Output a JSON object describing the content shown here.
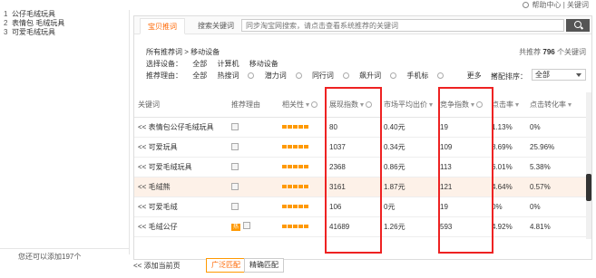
{
  "top_help": "帮助中心 | 关键词",
  "sidebar": {
    "items": [
      {
        "idx": "1",
        "label": "公仔毛绒玩具"
      },
      {
        "idx": "2",
        "label": "表情包 毛绒玩具"
      },
      {
        "idx": "3",
        "label": "可爱毛绒玩具"
      }
    ],
    "footer": "您还可以添加197个"
  },
  "tabs": {
    "active": "宝贝推词",
    "other": "搜索关键词"
  },
  "search": {
    "placeholder": "同步淘宝网搜索，请点击查看系统推荐的关键词"
  },
  "breadcrumb": "所有推荐词 > 移动设备",
  "total": {
    "prefix": "共推荐",
    "count": "796",
    "suffix": "个关键词"
  },
  "filters": {
    "device_label": "选择设备：",
    "device_options": [
      "全部",
      "计算机",
      "移动设备"
    ],
    "recommend_label": "推荐理由：",
    "recommend_options": [
      "全部",
      "热搜词",
      "潜力词",
      "同行词",
      "飙升词",
      "手机标"
    ],
    "more": "更多"
  },
  "sort": {
    "label": "搭配排序：",
    "value": "全部"
  },
  "table": {
    "headers": [
      "关键词",
      "推荐理由",
      "相关性",
      "展现指数",
      "市场平均出价",
      "竞争指数",
      "点击率",
      "点击转化率"
    ],
    "rows": [
      {
        "keyword": "<< 表情包公仔毛绒玩具",
        "impressions": "80",
        "price": "0.40元",
        "competition": "19",
        "ctr": "1.13%",
        "cvr": "0%",
        "hot": ""
      },
      {
        "keyword": "<< 可爱玩具",
        "impressions": "1037",
        "price": "0.34元",
        "competition": "109",
        "ctr": "8.69%",
        "cvr": "25.96%",
        "hot": ""
      },
      {
        "keyword": "<< 可爱毛绒玩具",
        "impressions": "2368",
        "price": "0.86元",
        "competition": "113",
        "ctr": "6.01%",
        "cvr": "5.38%",
        "hot": ""
      },
      {
        "keyword": "<< 毛绒熊",
        "impressions": "3161",
        "price": "1.87元",
        "competition": "121",
        "ctr": "4.64%",
        "cvr": "0.57%",
        "hot": ""
      },
      {
        "keyword": "<< 可爱毛绒",
        "impressions": "106",
        "price": "0元",
        "competition": "19",
        "ctr": "0%",
        "cvr": "0%",
        "hot": ""
      },
      {
        "keyword": "<< 毛绒公仔",
        "impressions": "41689",
        "price": "1.26元",
        "competition": "593",
        "ctr": "4.92%",
        "cvr": "4.81%",
        "hot": "热"
      }
    ]
  },
  "bottom": {
    "add_page": "<< 添加当前页",
    "broad_match": "广泛匹配",
    "exact_match": "精确匹配"
  },
  "colors": {
    "accent": "#ff6600",
    "highlight": "#dd2222",
    "row_highlight": "#fdf1e8"
  }
}
